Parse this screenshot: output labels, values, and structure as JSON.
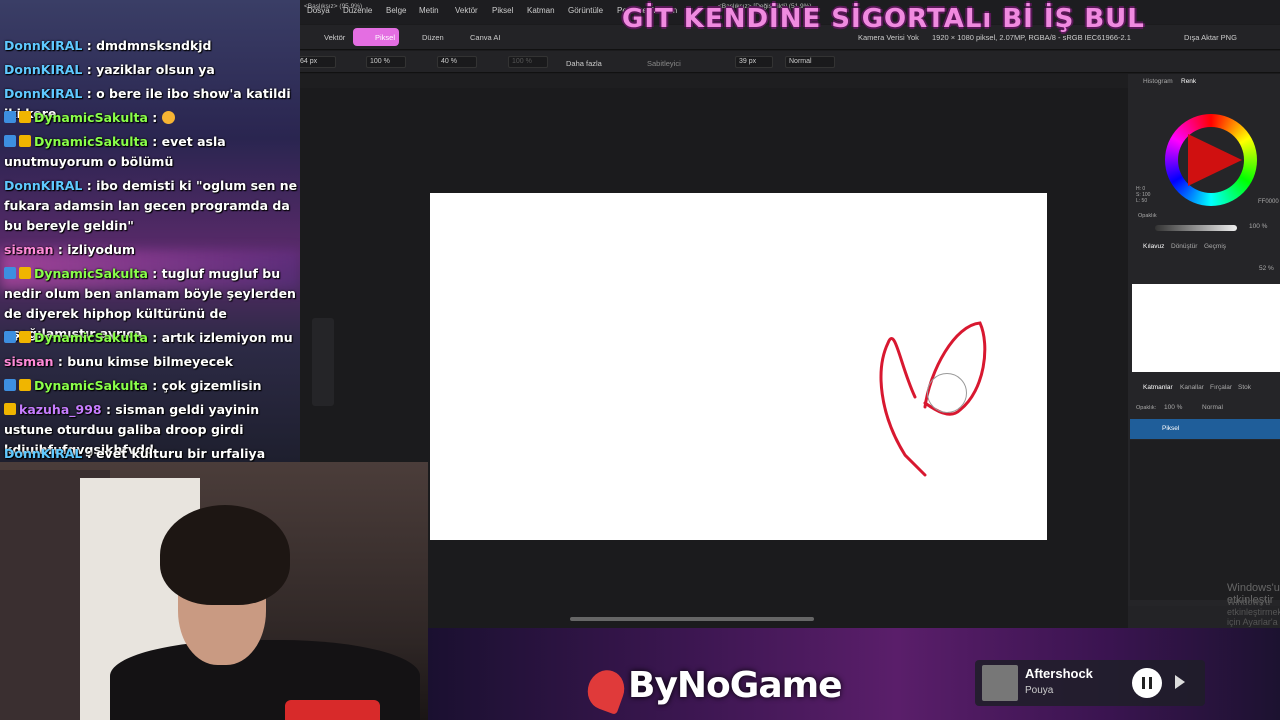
{
  "overlay_title": "GİT KENDİNE SİGORTALı Bİ İŞ BUL",
  "chat": [
    {
      "nick": "DonnKIRAL",
      "nick_color": "#5fc9ff",
      "badges": [],
      "text": ": dmdmnsksndkjd"
    },
    {
      "nick": "DonnKIRAL",
      "nick_color": "#5fc9ff",
      "badges": [],
      "text": ": yaziklar olsun ya"
    },
    {
      "nick": "DonnKIRAL",
      "nick_color": "#5fc9ff",
      "badges": [],
      "text": ": o bere ile ibo show'a katildi iki kere"
    },
    {
      "nick": "DynamicSakulta",
      "nick_color": "#8aff4a",
      "badges": [
        "b1",
        "b2"
      ],
      "text": ": ",
      "emoji": true
    },
    {
      "nick": "DynamicSakulta",
      "nick_color": "#8aff4a",
      "badges": [
        "b1",
        "b2"
      ],
      "text": ": evet asla unutmuyorum o bölümü"
    },
    {
      "nick": "DonnKIRAL",
      "nick_color": "#5fc9ff",
      "badges": [],
      "text": ": ibo demisti ki \"oglum sen ne fukara adamsin lan gecen programda da bu bereyle geldin\""
    },
    {
      "nick": "sisman",
      "nick_color": "#ff8ad8",
      "badges": [],
      "text": ": izliyodum"
    },
    {
      "nick": "DynamicSakulta",
      "nick_color": "#8aff4a",
      "badges": [
        "b1",
        "b2"
      ],
      "text": ": tugluf mugluf bu nedir olum ben anlamam böyle şeylerden de diyerek hiphop kültürünü de aşağılamıştır ayrıca"
    },
    {
      "nick": "DynamicSakulta",
      "nick_color": "#8aff4a",
      "badges": [
        "b1",
        "b2"
      ],
      "text": ": artık izlemiyon mu"
    },
    {
      "nick": "sisman",
      "nick_color": "#ff8ad8",
      "badges": [],
      "text": ": bunu kimse bilmeyecek"
    },
    {
      "nick": "DynamicSakulta",
      "nick_color": "#8aff4a",
      "badges": [
        "b1",
        "b2"
      ],
      "text": ": çok gizemlisin"
    },
    {
      "nick": "kazuha_998",
      "nick_color": "#c77dff",
      "badges": [
        "b2"
      ],
      "text": ": sisman geldi yayinin ustune oturduu galiba droop girdi kdjuihfufgvgsjkhfvdd"
    },
    {
      "nick": "DonnKIRAL",
      "nick_color": "#5fc9ff",
      "badges": [],
      "text": ": evet kulturu bir urfaliya ezdirmisti"
    }
  ],
  "menu": [
    "Dosya",
    "Düzenle",
    "Belge",
    "Metin",
    "Vektör",
    "Piksel",
    "Katman",
    "Görüntüle",
    "Pencere",
    "Yardım"
  ],
  "personas": {
    "vector": "Vektör",
    "pixel": "Piksel",
    "layout": "Düzen",
    "canva": "Canva AI"
  },
  "doc_info": {
    "camera": "Kamera Verisi Yok",
    "meta": "1920 × 1080 piksel, 2.07MP, RGBA/8 - sRGB IEC61966-2.1",
    "export": "Dışa Aktar PNG"
  },
  "toolbar": {
    "size": "64 px",
    "opacity": "100 %",
    "flow": "40 %",
    "hardness": "100 %",
    "more": "Daha fazla",
    "stabilizer": "Sabitleyici",
    "width": "39 px",
    "blend": "Normal"
  },
  "doc_tabs": [
    "<Başlıksız> (95.9%)",
    "<Başlıksız> [Değiştirildi] (51.9%)"
  ],
  "color_panel": {
    "tabs": [
      "Histogram",
      "Renk"
    ],
    "hex": "FF0000",
    "opacity_label": "Opaklık",
    "opacity": "100 %",
    "hsl": [
      "H: 0",
      "S: 100",
      "L: 50"
    ]
  },
  "nav_panel": {
    "tabs": [
      "Kılavuz",
      "Dönüştür",
      "Geçmiş"
    ],
    "zoom": "52 %"
  },
  "layers_panel": {
    "tabs": [
      "Katmanlar",
      "Kanallar",
      "Fırçalar",
      "Stok"
    ],
    "opacity_label": "Opaklık:",
    "opacity": "100 %",
    "blend": "Normal",
    "layer_name": "Piksel"
  },
  "watermark": [
    "Windows'u etkinleştir",
    "Windows'u etkinleştirmek için Ayarlar'a gidin."
  ],
  "brand": "ByNoGame",
  "now_playing": {
    "title": "Aftershock",
    "artist": "Pouya"
  },
  "colors": {
    "accent": "#e46ee2",
    "stroke": "#d81830",
    "layer_sel": "#1f5e9a"
  }
}
